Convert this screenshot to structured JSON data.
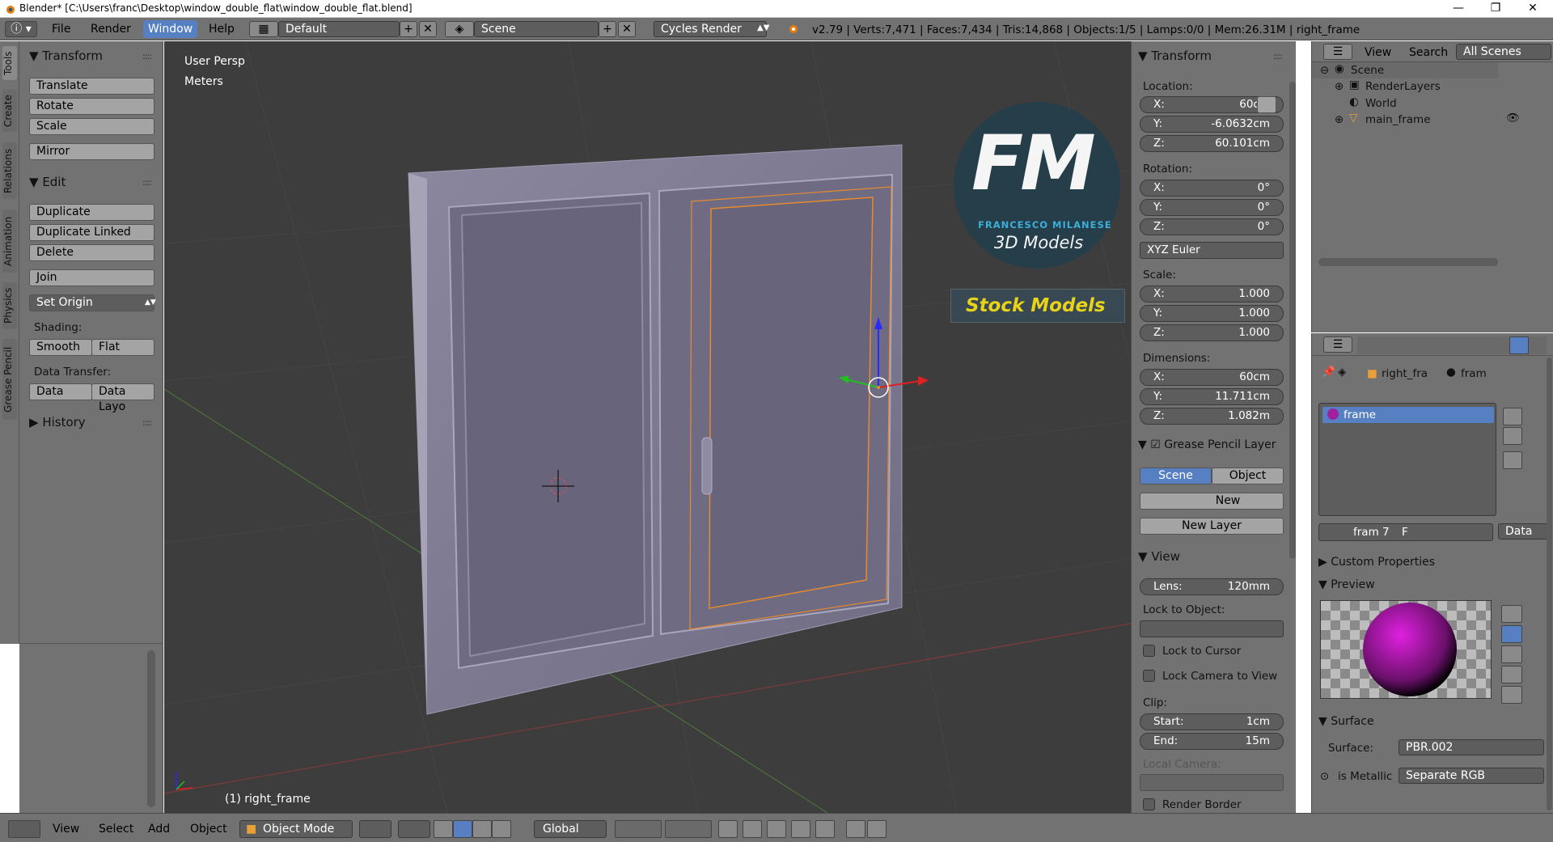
{
  "window": {
    "title": "Blender* [C:\\Users\\franc\\Desktop\\window_double_flat\\window_double_flat.blend]",
    "minimize": "—",
    "maximize": "❐",
    "close": "✕"
  },
  "header": {
    "menus": [
      "File",
      "Render",
      "Window",
      "Help"
    ],
    "layout": "Default",
    "scene": "Scene",
    "engine": "Cycles Render",
    "stats": "v2.79 | Verts:7,471 | Faces:7,434 | Tris:14,868 | Objects:1/5 | Lamps:0/0 | Mem:26.31M | right_frame"
  },
  "tabs": [
    "Tools",
    "Create",
    "Relations",
    "Animation",
    "Physics",
    "Grease Pencil"
  ],
  "toolshelf": {
    "transform_title": "Transform",
    "translate": "Translate",
    "rotate": "Rotate",
    "scale": "Scale",
    "mirror": "Mirror",
    "edit_title": "Edit",
    "duplicate": "Duplicate",
    "duplicate_linked": "Duplicate Linked",
    "delete": "Delete",
    "join": "Join",
    "set_origin": "Set Origin",
    "shading_label": "Shading:",
    "smooth": "Smooth",
    "flat": "Flat",
    "data_transfer_label": "Data Transfer:",
    "data": "Data",
    "data_layout": "Data Layo",
    "history_title": "History"
  },
  "viewport": {
    "view_name": "User Persp",
    "units": "Meters",
    "object_label": "(1) right_frame",
    "logo_letters": "FM",
    "logo_name": "FRANCESCO MILANESE",
    "logo_sub": "3D Models",
    "stock": "Stock Models"
  },
  "npanel": {
    "transform_title": "Transform",
    "location_label": "Location:",
    "location": [
      {
        "k": "X:",
        "v": "60cm"
      },
      {
        "k": "Y:",
        "v": "-6.0632cm"
      },
      {
        "k": "Z:",
        "v": "60.101cm"
      }
    ],
    "rotation_label": "Rotation:",
    "rotation": [
      {
        "k": "X:",
        "v": "0°"
      },
      {
        "k": "Y:",
        "v": "0°"
      },
      {
        "k": "Z:",
        "v": "0°"
      }
    ],
    "rotation_mode": "XYZ Euler",
    "scale_label": "Scale:",
    "scale": [
      {
        "k": "X:",
        "v": "1.000"
      },
      {
        "k": "Y:",
        "v": "1.000"
      },
      {
        "k": "Z:",
        "v": "1.000"
      }
    ],
    "dimensions_label": "Dimensions:",
    "dimensions": [
      {
        "k": "X:",
        "v": "60cm"
      },
      {
        "k": "Y:",
        "v": "11.711cm"
      },
      {
        "k": "Z:",
        "v": "1.082m"
      }
    ],
    "gp_title": "Grease Pencil Layer",
    "gp_scene": "Scene",
    "gp_object": "Object",
    "gp_new": "New",
    "gp_new_layer": "New Layer",
    "view_title": "View",
    "lens_k": "Lens:",
    "lens_v": "120mm",
    "lock_to_object": "Lock to Object:",
    "lock_to_cursor": "Lock to Cursor",
    "lock_camera": "Lock Camera to View",
    "clip_label": "Clip:",
    "clip_start_k": "Start:",
    "clip_start_v": "1cm",
    "clip_end_k": "End:",
    "clip_end_v": "15m",
    "local_camera": "Local Camera:",
    "render_border": "Render Border"
  },
  "outliner": {
    "view": "View",
    "search": "Search",
    "filter": "All Scenes",
    "items": [
      "Scene",
      "RenderLayers",
      "World",
      "main_frame"
    ]
  },
  "properties": {
    "breadcrumb_obj": "right_fra",
    "breadcrumb_mat": "fram",
    "material_slot": "frame",
    "mat_name": "fram",
    "mat_users": "7",
    "mat_f": "F",
    "link": "Data",
    "custom_props": "Custom Properties",
    "preview": "Preview",
    "surface_title": "Surface",
    "surface_label": "Surface:",
    "surface_value": "PBR.002",
    "metallic_label": "is Metallic",
    "metallic_value": "Separate RGB"
  },
  "footer": {
    "view": "View",
    "select": "Select",
    "add": "Add",
    "object": "Object",
    "mode": "Object Mode",
    "orientation": "Global"
  }
}
